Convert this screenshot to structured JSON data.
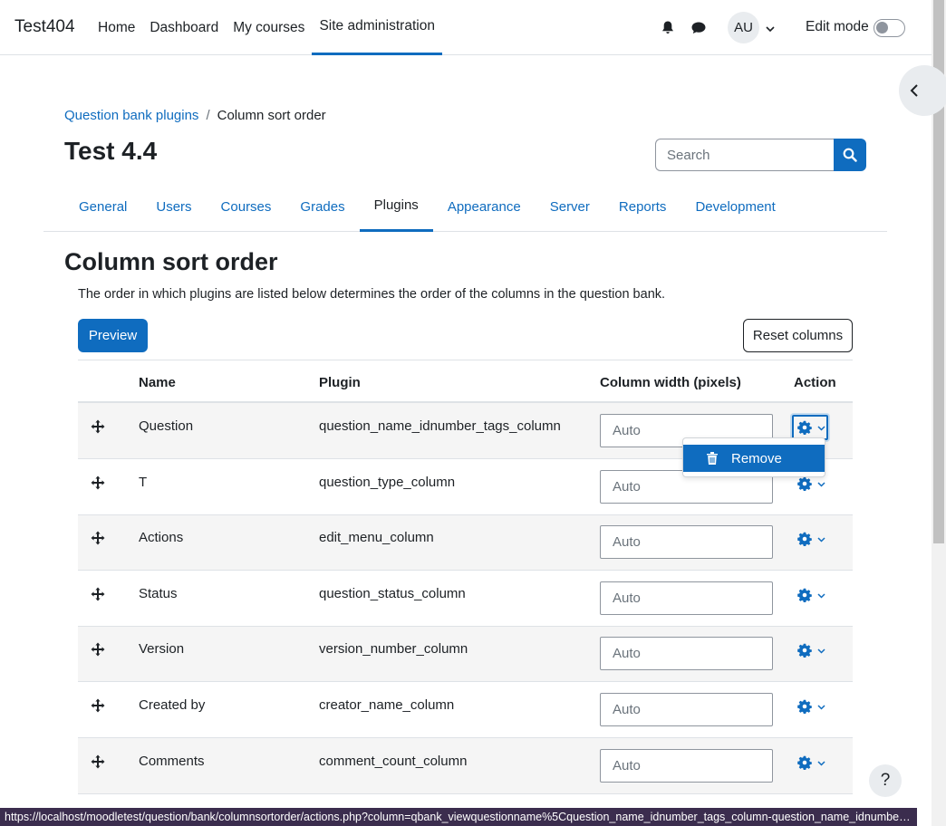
{
  "navbar": {
    "brand": "Test404",
    "items": [
      "Home",
      "Dashboard",
      "My courses",
      "Site administration"
    ],
    "active_index": 3,
    "avatar_initials": "AU",
    "edit_mode_label": "Edit mode"
  },
  "breadcrumb": {
    "link": "Question bank plugins",
    "separator": "/",
    "current": "Column sort order"
  },
  "page_title": "Test 4.4",
  "search": {
    "placeholder": "Search"
  },
  "tabs": [
    "General",
    "Users",
    "Courses",
    "Grades",
    "Plugins",
    "Appearance",
    "Server",
    "Reports",
    "Development"
  ],
  "active_tab_index": 4,
  "section": {
    "title": "Column sort order",
    "description": "The order in which plugins are listed below determines the order of the columns in the question bank."
  },
  "buttons": {
    "preview": "Preview",
    "reset": "Reset columns"
  },
  "table": {
    "headers": {
      "name": "Name",
      "plugin": "Plugin",
      "width": "Column width (pixels)",
      "action": "Action"
    },
    "width_placeholder": "Auto",
    "rows": [
      {
        "name": "Question",
        "plugin": "question_name_idnumber_tags_column"
      },
      {
        "name": "T",
        "plugin": "question_type_column"
      },
      {
        "name": "Actions",
        "plugin": "edit_menu_column"
      },
      {
        "name": "Status",
        "plugin": "question_status_column"
      },
      {
        "name": "Version",
        "plugin": "version_number_column"
      },
      {
        "name": "Created by",
        "plugin": "creator_name_column"
      },
      {
        "name": "Comments",
        "plugin": "comment_count_column"
      }
    ]
  },
  "dropdown": {
    "remove_label": "Remove"
  },
  "help_label": "?",
  "status_url": "https://localhost/moodletest/question/bank/columnsortorder/actions.php?column=qbank_viewquestionname%5Cquestion_name_idnumber_tags_column-question_name_idnumber_tags_...",
  "colors": {
    "primary": "#0f6cbf",
    "text": "#1d2125",
    "row_alt": "#f5f5f5"
  }
}
